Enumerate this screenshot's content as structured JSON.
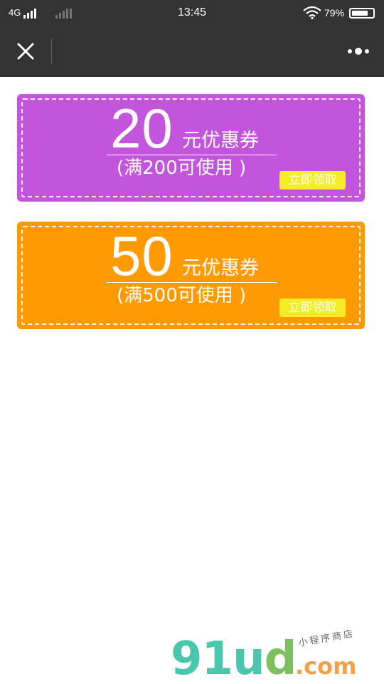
{
  "status_bar": {
    "network": "4G",
    "time": "13:45",
    "battery_percent": "79%",
    "battery_level": 0.79,
    "icons": [
      "signal-bars-icon",
      "signal-bars-weak-icon",
      "wifi-icon",
      "battery-icon"
    ]
  },
  "nav": {
    "close_icon": "close-icon",
    "more_icon": "more-dots-icon"
  },
  "coupons": [
    {
      "amount": "20",
      "unit": "元优惠券",
      "condition": "(满200可使用 )",
      "claim_label": "立即领取",
      "color": "#c354dc"
    },
    {
      "amount": "50",
      "unit": "元优惠券",
      "condition": "(满500可使用 )",
      "claim_label": "立即领取",
      "color": "#ff9a02"
    }
  ],
  "claim_button_color": "#f4ec24",
  "watermark": {
    "logo_part1": "91u",
    "logo_part2": "d",
    "dotcom": ".com",
    "tagline": "小程序商店"
  }
}
